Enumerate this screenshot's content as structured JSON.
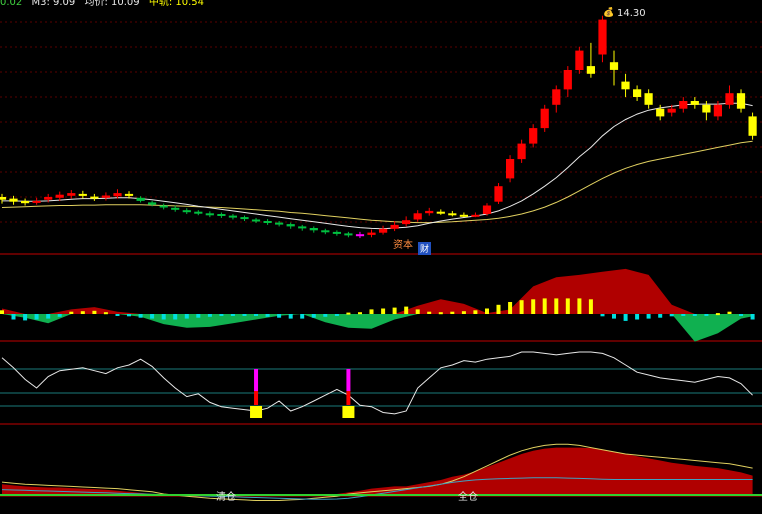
{
  "legend": [
    {
      "text": "0.02",
      "color": "#40d040"
    },
    {
      "text": "M3: 9.09",
      "color": "#e8e8e8"
    },
    {
      "text": "均价: 10.09",
      "color": "#e8e8e8"
    },
    {
      "text": "中轨: 10.54",
      "color": "#ffff00"
    }
  ],
  "colors": {
    "up": "#ff0000",
    "down_filled": "#00c040",
    "yellow": "#ffff00",
    "magenta": "#ff00ff",
    "axis_line": "#c00000",
    "cyan": "#00d0d0",
    "ma_line": "#e8e8e8",
    "mid_band": "#e0d060",
    "dark_red_fill": "#b00000",
    "green_fill": "#10b050"
  },
  "price_annotations": {
    "peak_label": "14.30",
    "bottom_label": "资本",
    "bottom_badge": "财"
  },
  "indicator_labels": {
    "sell": "清仓",
    "buy": "全仓"
  },
  "chart_data": [
    {
      "type": "candlestick",
      "panel": "price",
      "title": "",
      "ylim": [
        8.2,
        14.5
      ],
      "candles": [
        [
          9.62,
          9.55,
          9.45,
          9.7
        ],
        [
          9.58,
          9.5,
          9.42,
          9.65
        ],
        [
          9.52,
          9.46,
          9.4,
          9.58
        ],
        [
          9.47,
          9.52,
          9.42,
          9.6
        ],
        [
          9.55,
          9.62,
          9.48,
          9.7
        ],
        [
          9.6,
          9.68,
          9.52,
          9.76
        ],
        [
          9.65,
          9.72,
          9.58,
          9.8
        ],
        [
          9.7,
          9.66,
          9.58,
          9.78
        ],
        [
          9.63,
          9.58,
          9.52,
          9.7
        ],
        [
          9.6,
          9.66,
          9.53,
          9.74
        ],
        [
          9.64,
          9.72,
          9.58,
          9.82
        ],
        [
          9.7,
          9.65,
          9.58,
          9.77
        ],
        [
          9.6,
          9.52,
          9.48,
          9.64
        ],
        [
          9.48,
          9.42,
          9.38,
          9.52
        ],
        [
          9.4,
          9.36,
          9.3,
          9.45
        ],
        [
          9.34,
          9.3,
          9.24,
          9.4
        ],
        [
          9.28,
          9.24,
          9.18,
          9.33
        ],
        [
          9.24,
          9.2,
          9.15,
          9.28
        ],
        [
          9.2,
          9.16,
          9.1,
          9.25
        ],
        [
          9.18,
          9.14,
          9.08,
          9.22
        ],
        [
          9.14,
          9.1,
          9.04,
          9.18
        ],
        [
          9.1,
          9.05,
          9.0,
          9.14
        ],
        [
          9.04,
          9.0,
          8.95,
          9.08
        ],
        [
          9.0,
          8.96,
          8.9,
          9.05
        ],
        [
          8.96,
          8.92,
          8.86,
          9.0
        ],
        [
          8.92,
          8.86,
          8.8,
          8.96
        ],
        [
          8.86,
          8.82,
          8.75,
          8.9
        ],
        [
          8.82,
          8.76,
          8.7,
          8.86
        ],
        [
          8.76,
          8.72,
          8.66,
          8.8
        ],
        [
          8.72,
          8.68,
          8.62,
          8.76
        ],
        [
          8.68,
          8.64,
          8.58,
          8.72
        ],
        [
          8.62,
          8.66,
          8.56,
          8.72
        ],
        [
          8.64,
          8.7,
          8.58,
          8.78
        ],
        [
          8.7,
          8.8,
          8.65,
          8.88
        ],
        [
          8.8,
          8.9,
          8.74,
          9.0
        ],
        [
          8.92,
          9.02,
          8.86,
          9.12
        ],
        [
          9.04,
          9.2,
          8.98,
          9.28
        ],
        [
          9.2,
          9.26,
          9.14,
          9.34
        ],
        [
          9.24,
          9.2,
          9.16,
          9.3
        ],
        [
          9.2,
          9.16,
          9.12,
          9.26
        ],
        [
          9.16,
          9.14,
          9.1,
          9.22
        ],
        [
          9.14,
          9.16,
          9.1,
          9.22
        ],
        [
          9.18,
          9.4,
          9.14,
          9.46
        ],
        [
          9.5,
          9.9,
          9.44,
          9.98
        ],
        [
          10.1,
          10.6,
          10.0,
          10.7
        ],
        [
          10.6,
          11.0,
          10.5,
          11.1
        ],
        [
          11.0,
          11.4,
          10.9,
          11.5
        ],
        [
          11.4,
          11.9,
          11.3,
          12.0
        ],
        [
          12.0,
          12.4,
          11.8,
          12.5
        ],
        [
          12.4,
          12.9,
          12.2,
          13.0
        ],
        [
          12.9,
          13.4,
          12.8,
          13.5
        ],
        [
          13.0,
          12.8,
          12.7,
          13.6
        ],
        [
          13.3,
          14.2,
          13.1,
          14.3
        ],
        [
          13.1,
          12.9,
          12.5,
          13.4
        ],
        [
          12.6,
          12.4,
          12.2,
          12.8
        ],
        [
          12.4,
          12.2,
          12.1,
          12.5
        ],
        [
          12.3,
          12.0,
          11.9,
          12.4
        ],
        [
          11.9,
          11.7,
          11.6,
          12.0
        ],
        [
          11.8,
          11.9,
          11.7,
          12.0
        ],
        [
          11.9,
          12.1,
          11.8,
          12.2
        ],
        [
          12.1,
          12.0,
          11.9,
          12.2
        ],
        [
          12.0,
          11.8,
          11.6,
          12.1
        ],
        [
          11.7,
          12.0,
          11.6,
          12.1
        ],
        [
          12.0,
          12.3,
          11.9,
          12.5
        ],
        [
          12.3,
          11.9,
          11.8,
          12.4
        ],
        [
          11.7,
          11.2,
          11.1,
          11.8
        ]
      ],
      "ma": [
        9.52,
        9.52,
        9.51,
        9.51,
        9.52,
        9.54,
        9.56,
        9.58,
        9.58,
        9.59,
        9.6,
        9.6,
        9.58,
        9.55,
        9.51,
        9.47,
        9.43,
        9.38,
        9.34,
        9.3,
        9.26,
        9.22,
        9.18,
        9.14,
        9.1,
        9.06,
        9.02,
        8.98,
        8.94,
        8.9,
        8.86,
        8.83,
        8.81,
        8.8,
        8.82,
        8.84,
        8.88,
        8.94,
        9.0,
        9.05,
        9.09,
        9.13,
        9.18,
        9.26,
        9.38,
        9.52,
        9.7,
        9.9,
        10.12,
        10.38,
        10.66,
        10.9,
        11.2,
        11.44,
        11.62,
        11.76,
        11.86,
        11.92,
        11.96,
        12.0,
        12.02,
        12.02,
        12.02,
        12.04,
        12.04,
        11.98
      ],
      "mid": [
        9.35,
        9.36,
        9.37,
        9.38,
        9.39,
        9.4,
        9.4,
        9.41,
        9.41,
        9.42,
        9.42,
        9.42,
        9.42,
        9.41,
        9.4,
        9.39,
        9.38,
        9.37,
        9.36,
        9.35,
        9.33,
        9.31,
        9.29,
        9.27,
        9.25,
        9.22,
        9.2,
        9.17,
        9.14,
        9.11,
        9.08,
        9.05,
        9.02,
        9.0,
        8.98,
        8.97,
        8.96,
        8.96,
        8.97,
        8.98,
        9.0,
        9.02,
        9.04,
        9.07,
        9.12,
        9.18,
        9.26,
        9.36,
        9.48,
        9.62,
        9.78,
        9.94,
        10.1,
        10.24,
        10.36,
        10.46,
        10.54,
        10.6,
        10.66,
        10.72,
        10.78,
        10.84,
        10.9,
        10.96,
        11.02,
        11.06
      ]
    },
    {
      "type": "area",
      "panel": "oscillator",
      "ylim": [
        -1,
        1
      ],
      "x": [
        0,
        2,
        4,
        6,
        8,
        10,
        12,
        14,
        16,
        18,
        20,
        22,
        24,
        26,
        28,
        30,
        32,
        34,
        36,
        38,
        40,
        42,
        44,
        46,
        48,
        50,
        52,
        54,
        56,
        58,
        60,
        62,
        64,
        65
      ],
      "values": [
        0.12,
        -0.08,
        -0.2,
        0.1,
        0.15,
        0.05,
        -0.06,
        -0.22,
        -0.3,
        -0.28,
        -0.2,
        -0.12,
        -0.04,
        0.0,
        -0.18,
        -0.3,
        -0.32,
        -0.12,
        0.18,
        0.32,
        0.22,
        0.02,
        0.1,
        0.6,
        0.8,
        0.85,
        0.92,
        0.98,
        0.85,
        0.2,
        -0.6,
        -0.42,
        -0.1,
        -0.05
      ],
      "bars": [
        0.08,
        -0.12,
        -0.14,
        -0.12,
        -0.1,
        -0.06,
        0.05,
        0.06,
        0.07,
        0.04,
        -0.03,
        -0.05,
        -0.08,
        -0.1,
        -0.12,
        -0.12,
        -0.1,
        -0.08,
        -0.06,
        -0.04,
        -0.03,
        -0.02,
        -0.04,
        -0.06,
        -0.08,
        -0.1,
        -0.1,
        -0.08,
        -0.06,
        -0.03,
        0.03,
        0.04,
        0.1,
        0.12,
        0.14,
        0.16,
        0.1,
        0.05,
        0.04,
        0.05,
        0.06,
        0.08,
        0.12,
        0.2,
        0.26,
        0.3,
        0.32,
        0.34,
        0.34,
        0.34,
        0.34,
        0.32,
        -0.05,
        -0.1,
        -0.15,
        -0.12,
        -0.1,
        -0.08,
        -0.05,
        -0.03,
        -0.02,
        -0.02,
        0.02,
        0.05,
        -0.04,
        -0.12
      ]
    },
    {
      "type": "line",
      "panel": "kdj",
      "ylim": [
        0,
        100
      ],
      "values": [
        92,
        78,
        62,
        50,
        66,
        74,
        76,
        78,
        74,
        70,
        78,
        82,
        90,
        80,
        64,
        50,
        38,
        42,
        30,
        24,
        22,
        20,
        18,
        22,
        32,
        18,
        24,
        32,
        40,
        48,
        40,
        26,
        24,
        16,
        14,
        18,
        50,
        64,
        78,
        82,
        88,
        86,
        90,
        92,
        94,
        100,
        100,
        98,
        96,
        98,
        100,
        100,
        98,
        92,
        82,
        72,
        68,
        64,
        62,
        60,
        58,
        62,
        66,
        64,
        56,
        40
      ],
      "signals": [
        {
          "index": 22,
          "value": 18,
          "type": "buy"
        },
        {
          "index": 30,
          "value": 16,
          "type": "buy"
        }
      ]
    },
    {
      "type": "area",
      "panel": "position",
      "ylim": [
        -1,
        1
      ],
      "values": [
        0.18,
        0.16,
        0.14,
        0.13,
        0.12,
        0.12,
        0.11,
        0.1,
        0.09,
        0.08,
        0.06,
        0.04,
        0.02,
        0.0,
        -0.04,
        -0.06,
        -0.08,
        -0.1,
        -0.12,
        -0.12,
        -0.14,
        -0.14,
        -0.15,
        -0.15,
        -0.14,
        -0.14,
        -0.12,
        -0.1,
        -0.06,
        -0.02,
        0.03,
        0.06,
        0.1,
        0.12,
        0.14,
        0.14,
        0.18,
        0.22,
        0.26,
        0.32,
        0.36,
        0.42,
        0.5,
        0.58,
        0.66,
        0.74,
        0.8,
        0.84,
        0.86,
        0.86,
        0.86,
        0.85,
        0.82,
        0.78,
        0.74,
        0.7,
        0.66,
        0.62,
        0.58,
        0.55,
        0.52,
        0.5,
        0.48,
        0.44,
        0.4,
        0.34
      ],
      "line": [
        0.22,
        0.2,
        0.18,
        0.17,
        0.16,
        0.15,
        0.14,
        0.13,
        0.12,
        0.11,
        0.1,
        0.08,
        0.06,
        0.04,
        0.0,
        -0.02,
        -0.04,
        -0.06,
        -0.08,
        -0.09,
        -0.1,
        -0.11,
        -0.12,
        -0.12,
        -0.12,
        -0.11,
        -0.1,
        -0.08,
        -0.06,
        -0.04,
        0.0,
        0.02,
        0.04,
        0.06,
        0.08,
        0.1,
        0.12,
        0.14,
        0.18,
        0.24,
        0.32,
        0.42,
        0.52,
        0.62,
        0.72,
        0.8,
        0.86,
        0.9,
        0.92,
        0.92,
        0.9,
        0.86,
        0.82,
        0.78,
        0.74,
        0.72,
        0.7,
        0.68,
        0.66,
        0.64,
        0.62,
        0.6,
        0.58,
        0.56,
        0.52,
        0.48
      ],
      "baseline_line": [
        -0.2,
        -0.22,
        -0.24,
        -0.26,
        -0.28,
        -0.3,
        -0.32,
        -0.34,
        -0.36,
        -0.38,
        -0.4,
        -0.42,
        -0.44,
        -0.46,
        -0.48,
        -0.5,
        -0.52,
        -0.54,
        -0.56,
        -0.58,
        -0.6,
        -0.62,
        -0.64,
        -0.66,
        -0.68,
        -0.7,
        -0.72,
        -0.74,
        -0.74,
        -0.72,
        -0.68,
        -0.6,
        -0.5,
        -0.4,
        -0.3,
        -0.2,
        -0.1,
        0.0,
        0.1,
        0.2,
        0.28,
        0.34,
        0.38,
        0.4,
        0.42,
        0.44,
        0.46,
        0.46,
        0.46,
        0.44,
        0.42,
        0.4,
        0.38,
        0.36,
        0.36,
        0.36,
        0.36,
        0.36,
        0.36,
        0.36,
        0.36,
        0.36,
        0.36,
        0.36,
        0.36,
        0.36
      ]
    }
  ]
}
